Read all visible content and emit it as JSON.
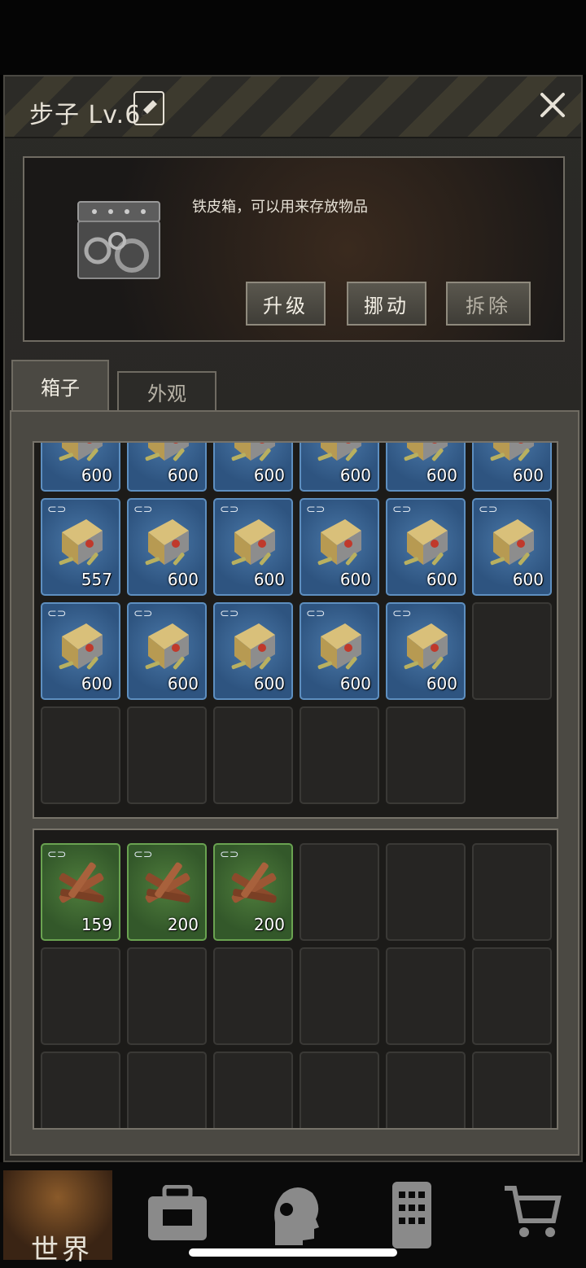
{
  "header": {
    "title": "步子 Lv.6",
    "edit_icon": "pencil-icon",
    "close_icon": "close-icon"
  },
  "info": {
    "description": "铁皮箱，可以用来存放物品",
    "buttons": {
      "upgrade": "升级",
      "move": "挪动",
      "remove": "拆除"
    }
  },
  "tabs": {
    "box": "箱子",
    "appearance": "外观"
  },
  "storage_top": [
    {
      "type": "ammo",
      "count": "600",
      "linked": false
    },
    {
      "type": "ammo",
      "count": "600",
      "linked": false
    },
    {
      "type": "ammo",
      "count": "600",
      "linked": false
    },
    {
      "type": "ammo",
      "count": "600",
      "linked": false
    },
    {
      "type": "ammo",
      "count": "600",
      "linked": false
    },
    {
      "type": "ammo",
      "count": "600",
      "linked": false
    },
    {
      "type": "ammo",
      "count": "557",
      "linked": true
    },
    {
      "type": "ammo",
      "count": "600",
      "linked": true
    },
    {
      "type": "ammo",
      "count": "600",
      "linked": true
    },
    {
      "type": "ammo",
      "count": "600",
      "linked": true
    },
    {
      "type": "ammo",
      "count": "600",
      "linked": true
    },
    {
      "type": "ammo",
      "count": "600",
      "linked": true
    },
    {
      "type": "ammo",
      "count": "600",
      "linked": true
    },
    {
      "type": "ammo",
      "count": "600",
      "linked": true
    },
    {
      "type": "ammo",
      "count": "600",
      "linked": true
    },
    {
      "type": "ammo",
      "count": "600",
      "linked": true
    },
    {
      "type": "ammo",
      "count": "600",
      "linked": true
    },
    {
      "type": "empty",
      "count": "",
      "linked": false
    },
    {
      "type": "empty",
      "count": "",
      "linked": false
    },
    {
      "type": "empty",
      "count": "",
      "linked": false
    },
    {
      "type": "empty",
      "count": "",
      "linked": false
    },
    {
      "type": "empty",
      "count": "",
      "linked": false
    },
    {
      "type": "empty",
      "count": "",
      "linked": false
    }
  ],
  "storage_bottom": [
    {
      "type": "wood",
      "count": "159",
      "linked": true
    },
    {
      "type": "wood",
      "count": "200",
      "linked": true
    },
    {
      "type": "wood",
      "count": "200",
      "linked": true
    },
    {
      "type": "empty",
      "count": "",
      "linked": false
    },
    {
      "type": "empty",
      "count": "",
      "linked": false
    },
    {
      "type": "empty",
      "count": "",
      "linked": false
    },
    {
      "type": "empty",
      "count": "",
      "linked": false
    },
    {
      "type": "empty",
      "count": "",
      "linked": false
    },
    {
      "type": "empty",
      "count": "",
      "linked": false
    },
    {
      "type": "empty",
      "count": "",
      "linked": false
    },
    {
      "type": "empty",
      "count": "",
      "linked": false
    },
    {
      "type": "empty",
      "count": "",
      "linked": false
    },
    {
      "type": "empty",
      "count": "",
      "linked": false
    },
    {
      "type": "empty",
      "count": "",
      "linked": false
    },
    {
      "type": "empty",
      "count": "",
      "linked": false
    },
    {
      "type": "empty",
      "count": "",
      "linked": false
    },
    {
      "type": "empty",
      "count": "",
      "linked": false
    },
    {
      "type": "empty",
      "count": "",
      "linked": false
    }
  ],
  "bottom_nav": {
    "world_label": "世界",
    "icons": [
      "backpack-icon",
      "character-icon",
      "phone-icon",
      "shop-cart-icon"
    ]
  },
  "colors": {
    "ammo_slot": "#2e5480",
    "wood_slot": "#33582a",
    "panel": "#2b2a27"
  }
}
